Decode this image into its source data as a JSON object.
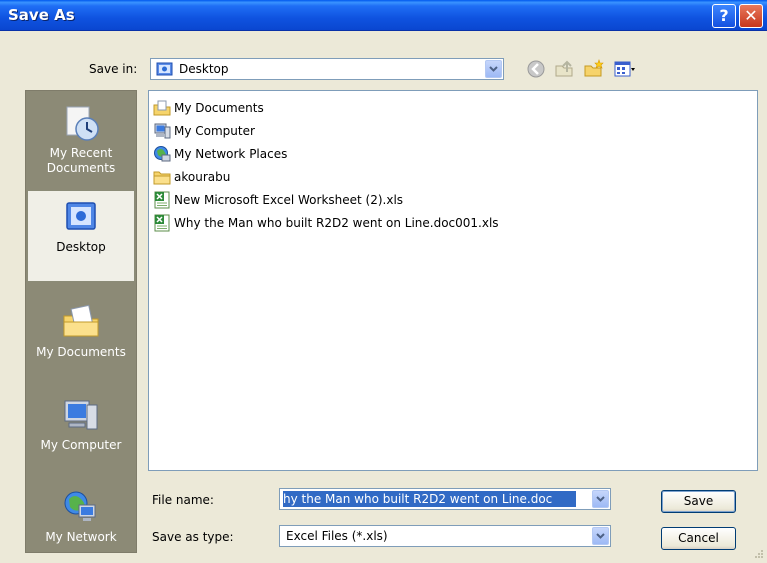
{
  "window": {
    "title": "Save As"
  },
  "toolbar": {
    "save_in_label": "Save in:",
    "save_in_value": "Desktop",
    "icons": [
      "back-icon",
      "up-folder-icon",
      "new-folder-icon",
      "views-menu-icon"
    ]
  },
  "places": [
    {
      "label": "My Recent\nDocuments",
      "icon": "recent-documents-icon"
    },
    {
      "label": "Desktop",
      "icon": "desktop-icon",
      "selected": true
    },
    {
      "label": "My Documents",
      "icon": "my-documents-icon"
    },
    {
      "label": "My Computer",
      "icon": "my-computer-icon"
    },
    {
      "label": "My Network",
      "icon": "my-network-icon"
    }
  ],
  "files": [
    {
      "name": "My Documents",
      "icon": "my-documents-folder-icon"
    },
    {
      "name": "My Computer",
      "icon": "my-computer-icon"
    },
    {
      "name": "My Network Places",
      "icon": "network-places-icon"
    },
    {
      "name": "akourabu",
      "icon": "folder-icon"
    },
    {
      "name": "New Microsoft Excel Worksheet (2).xls",
      "icon": "excel-file-icon"
    },
    {
      "name": "Why the Man who built R2D2 went on Line.doc001.xls",
      "icon": "excel-file-icon"
    }
  ],
  "form": {
    "file_name_label": "File name:",
    "file_name_value": "hy the Man who built R2D2 went on Line.doc",
    "save_type_label": "Save as type:",
    "save_type_value": "Excel Files (*.xls)"
  },
  "buttons": {
    "save": "Save",
    "cancel": "Cancel"
  },
  "colors": {
    "title_bar": "#0a46d0",
    "selection": "#316ac5",
    "places_bar": "#8c8a76",
    "dialog_bg": "#ece9d8"
  }
}
